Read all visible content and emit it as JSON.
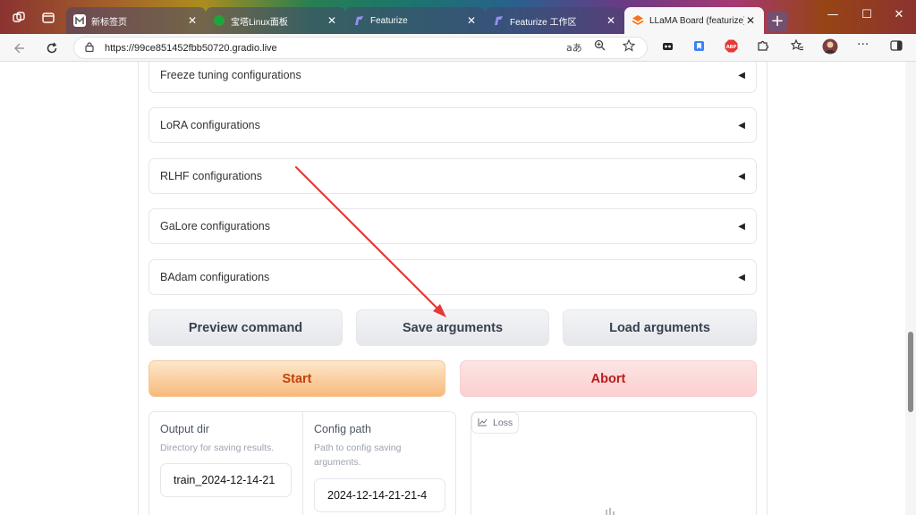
{
  "browser": {
    "tabs": [
      {
        "title": "新标签页",
        "close": "✕",
        "active": false
      },
      {
        "title": "宝塔Linux面板",
        "close": "✕",
        "active": false
      },
      {
        "title": "Featurize",
        "close": "✕",
        "active": false
      },
      {
        "title": "Featurize 工作区",
        "close": "✕",
        "active": false
      },
      {
        "title": "LLaMA Board (featurize)",
        "close": "✕",
        "active": true
      }
    ],
    "new_tab": "+",
    "window_controls": {
      "minimize": "—",
      "maximize": "☐",
      "close": "✕"
    },
    "url": "https://99ce851452fbb50720.gradio.live",
    "translate_label": "aあ"
  },
  "accordions": [
    {
      "label": "Freeze tuning configurations",
      "caret": "◀"
    },
    {
      "label": "LoRA configurations",
      "caret": "◀"
    },
    {
      "label": "RLHF configurations",
      "caret": "◀"
    },
    {
      "label": "GaLore configurations",
      "caret": "◀"
    },
    {
      "label": "BAdam configurations",
      "caret": "◀"
    }
  ],
  "buttons": {
    "preview": "Preview command",
    "save": "Save arguments",
    "load": "Load arguments",
    "start": "Start",
    "abort": "Abort"
  },
  "output_dir": {
    "label": "Output dir",
    "info": "Directory for saving results.",
    "value": "train_2024-12-14-21"
  },
  "config_path": {
    "label": "Config path",
    "info": "Path to config saving arguments.",
    "value": "2024-12-14-21-21-4"
  },
  "plot": {
    "label": "Loss"
  },
  "colors": {
    "annotation_arrow": "#e53935",
    "start_text": "#c2410c",
    "abort_text": "#b91c1c"
  }
}
